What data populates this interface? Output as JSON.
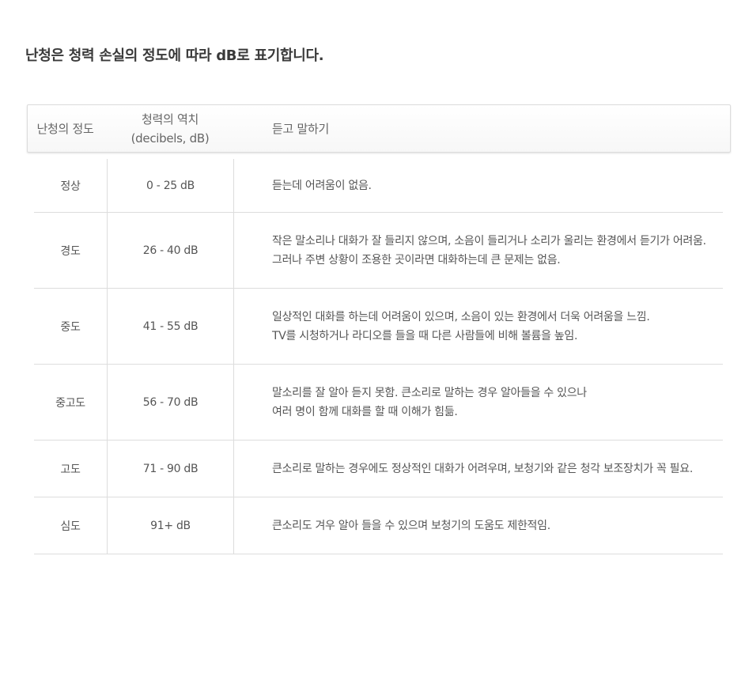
{
  "heading": "난청은 청력 손실의 정도에 따라 dB로 표기합니다.",
  "table": {
    "headers": {
      "level": "난청의 정도",
      "threshold_line1": "청력의 역치",
      "threshold_line2": "(decibels, dB)",
      "hearing": "듣고 말하기"
    },
    "rows": [
      {
        "level": "정상",
        "threshold": "0 - 25 dB",
        "hearing": [
          "듣는데 어려움이 없음."
        ]
      },
      {
        "level": "경도",
        "threshold": "26 - 40 dB",
        "hearing": [
          "작은 말소리나 대화가 잘 들리지 않으며, 소음이 들리거나 소리가 울리는 환경에서 듣기가 어려움.",
          "그러나 주변 상황이 조용한 곳이라면 대화하는데 큰 문제는 없음."
        ]
      },
      {
        "level": "중도",
        "threshold": "41 - 55 dB",
        "hearing": [
          "일상적인 대화를 하는데 어려움이 있으며, 소음이 있는 환경에서 더욱 어려움을 느낌.",
          "TV를 시청하거나 라디오를 들을 때 다른 사람들에 비해 볼륨을 높임."
        ]
      },
      {
        "level": "중고도",
        "threshold": "56 - 70 dB",
        "hearing": [
          "말소리를 잘 알아 듣지 못함. 큰소리로 말하는 경우 알아들을 수 있으나",
          "여러 명이 함께 대화를 할 때 이해가 힘듦."
        ]
      },
      {
        "level": "고도",
        "threshold": "71 - 90 dB",
        "hearing": [
          "큰소리로 말하는 경우에도 정상적인 대화가 어려우며, 보청기와 같은 청각 보조장치가 꼭 필요."
        ]
      },
      {
        "level": "심도",
        "threshold": "91+ dB",
        "hearing": [
          "큰소리도 겨우 알아 들을 수 있으며 보청기의 도움도 제한적임."
        ]
      }
    ]
  }
}
